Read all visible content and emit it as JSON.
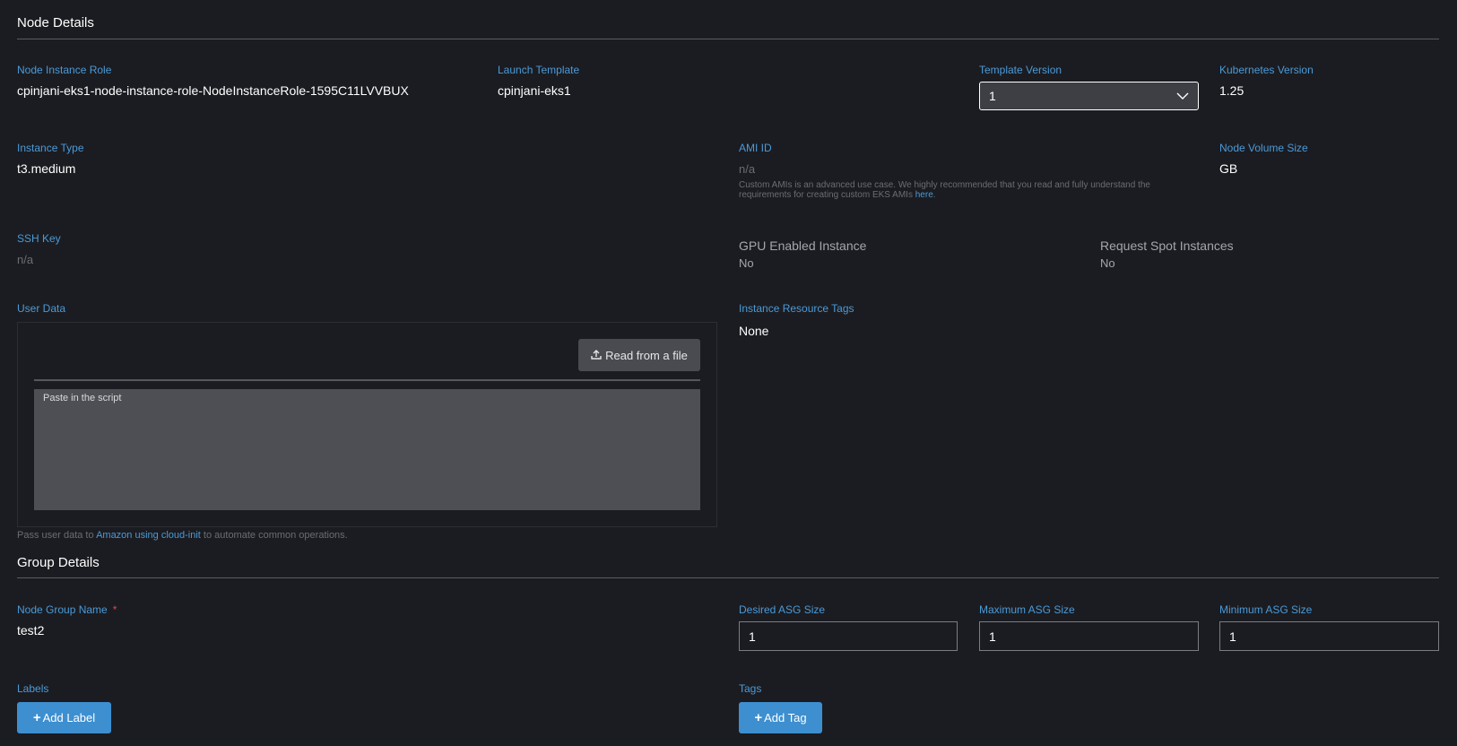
{
  "node_details": {
    "title": "Node Details",
    "node_instance_role": {
      "label": "Node Instance Role",
      "value": "cpinjani-eks1-node-instance-role-NodeInstanceRole-1595C11LVVBUX"
    },
    "launch_template": {
      "label": "Launch Template",
      "value": "cpinjani-eks1"
    },
    "template_version": {
      "label": "Template Version",
      "value": "1"
    },
    "kubernetes_version": {
      "label": "Kubernetes Version",
      "value": "1.25"
    },
    "instance_type": {
      "label": "Instance Type",
      "value": "t3.medium"
    },
    "ami_id": {
      "label": "AMI ID",
      "value": "n/a",
      "help_text": "Custom AMIs is an advanced use case. We highly recommended that you read and fully understand the requirements for creating custom EKS AMIs",
      "help_link": "here",
      "help_end": "."
    },
    "node_volume_size": {
      "label": "Node Volume Size",
      "value": "GB"
    },
    "ssh_key": {
      "label": "SSH Key",
      "value": "n/a"
    },
    "gpu_enabled": {
      "label": "GPU Enabled Instance",
      "value": "No"
    },
    "spot_instances": {
      "label": "Request Spot Instances",
      "value": "No"
    },
    "user_data": {
      "label": "User Data",
      "read_button": "Read from a file",
      "placeholder": "Paste in the script",
      "help_prefix": "Pass user data to",
      "help_link": "Amazon using cloud-init",
      "help_suffix": "to automate common operations."
    },
    "resource_tags": {
      "label": "Instance Resource Tags",
      "value": "None"
    }
  },
  "group_details": {
    "title": "Group Details",
    "node_group_name": {
      "label": "Node Group Name",
      "required_mark": "*",
      "value": "test2"
    },
    "desired_asg": {
      "label": "Desired ASG Size",
      "value": "1"
    },
    "max_asg": {
      "label": "Maximum ASG Size",
      "value": "1"
    },
    "min_asg": {
      "label": "Minimum ASG Size",
      "value": "1"
    },
    "labels": {
      "label": "Labels",
      "button": "Add Label"
    },
    "tags": {
      "label": "Tags",
      "button": "Add Tag"
    }
  },
  "icons": {
    "upload": "upload-icon",
    "chevron": "chevron-down-icon",
    "plus": "plus-icon"
  },
  "colors": {
    "background": "#1b1c21",
    "label_blue": "#4a9ad8",
    "button_blue": "#3d8fd0",
    "required_red": "#e0474c"
  }
}
